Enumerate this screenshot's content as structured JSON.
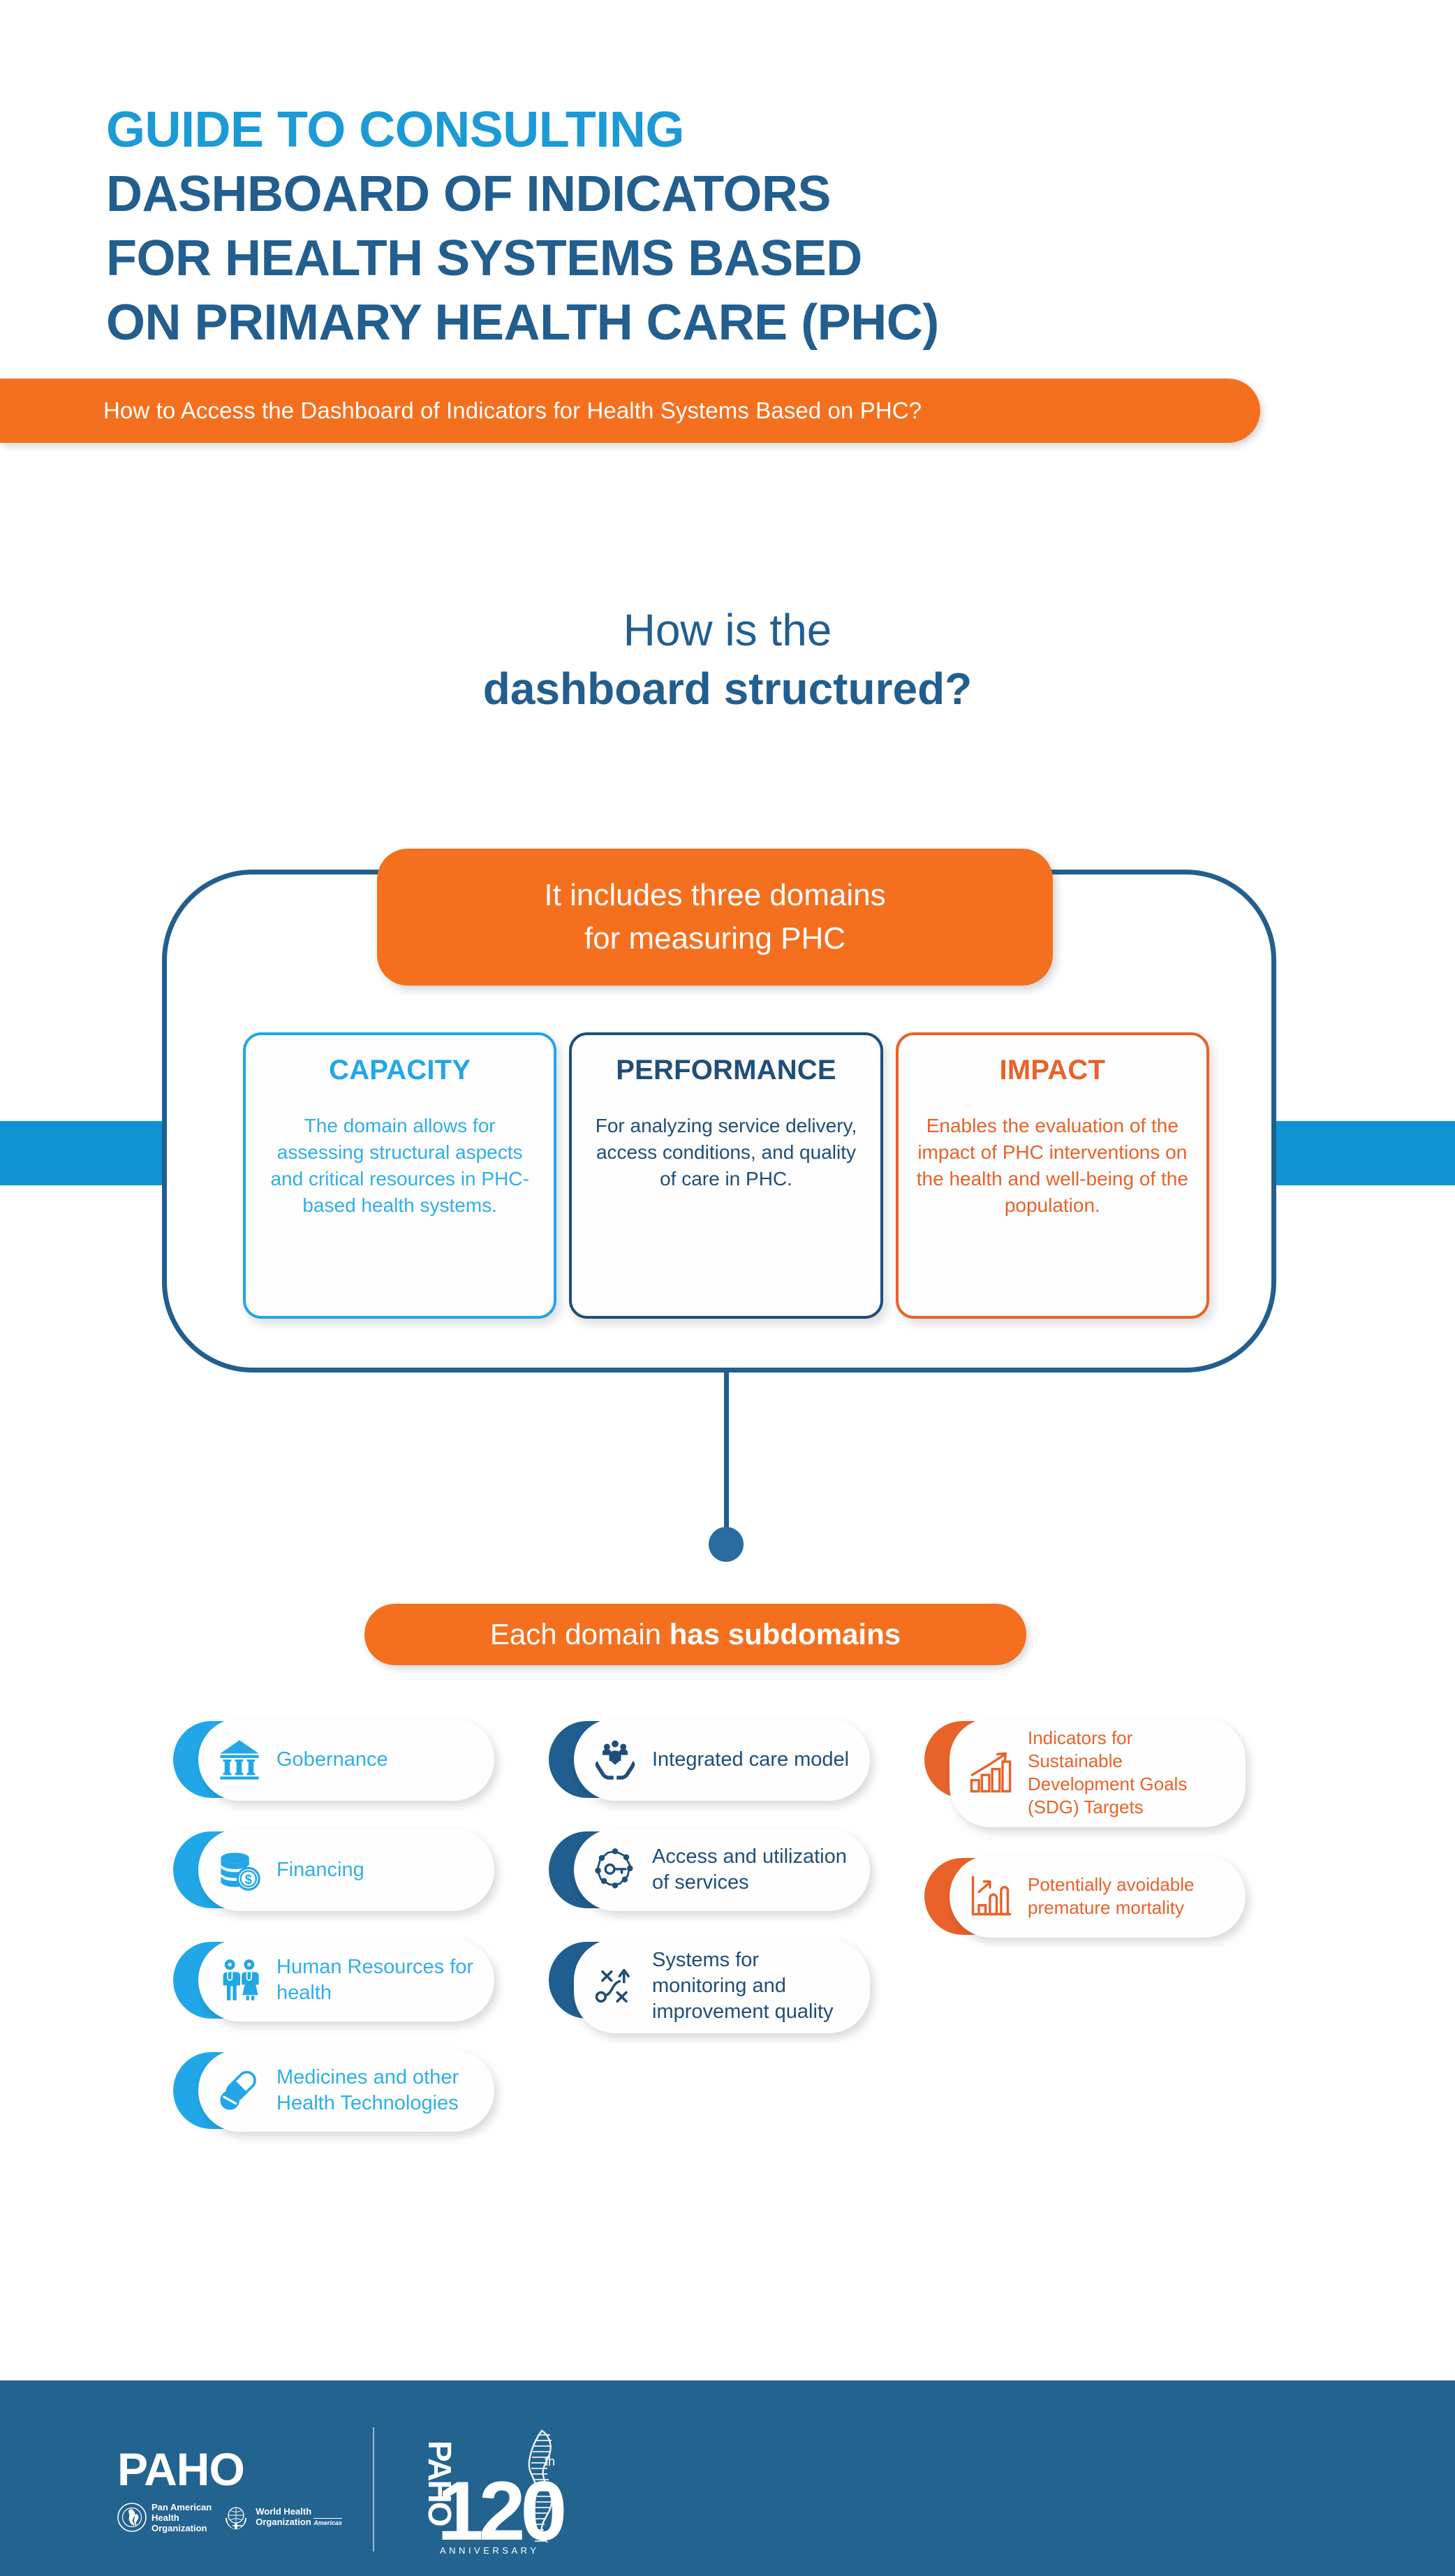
{
  "header": {
    "title_lines": [
      {
        "text": "GUIDE TO CONSULTING",
        "tone": "accent"
      },
      {
        "text": "DASHBOARD OF INDICATORS",
        "tone": "deep"
      },
      {
        "text": "FOR HEALTH SYSTEMS BASED",
        "tone": "deep"
      },
      {
        "text": "ON PRIMARY HEALTH CARE (PHC)",
        "tone": "deep"
      }
    ],
    "banner_text": "How to Access the Dashboard of Indicators for Health Systems Based on PHC?"
  },
  "section": {
    "question_line1": "How is the",
    "question_line2": "dashboard structured?"
  },
  "domains_banner": {
    "line1": "It includes three domains",
    "line2": "for measuring PHC"
  },
  "domains": [
    {
      "key": "capacity",
      "title": "CAPACITY",
      "body": "The domain allows for assessing structural aspects and critical resources in PHC-based health systems.",
      "color": "#21A7E8"
    },
    {
      "key": "performance",
      "title": "PERFORMANCE",
      "body": "For analyzing service delivery, access conditions, and quality of care in PHC.",
      "color": "#1F4E79"
    },
    {
      "key": "impact",
      "title": "IMPACT",
      "body": "Enables the evaluation of the impact of PHC interventions on the health and well-being of the population.",
      "color": "#E8622A"
    }
  ],
  "subdomains_banner": {
    "prefix": "Each domain ",
    "emphasis": "has subdomains"
  },
  "subdomain_columns": [
    {
      "key": "capacity",
      "color": "#21A7E8",
      "items": [
        {
          "label": "Gobernance",
          "icon": "bank-building-icon"
        },
        {
          "label": "Financing",
          "icon": "coins-dollar-icon"
        },
        {
          "label": "Human Resources for health",
          "icon": "health-workers-icon"
        },
        {
          "label": "Medicines and other Health Technologies",
          "icon": "pill-capsule-icon"
        }
      ]
    },
    {
      "key": "performance",
      "color": "#1F5E8F",
      "items": [
        {
          "label": "Integrated care model",
          "icon": "hands-people-heart-icon"
        },
        {
          "label": "Access and utilization of services",
          "icon": "key-network-icon"
        },
        {
          "label": "Systems for monitoring and improvement quality",
          "icon": "pathway-arrow-icon"
        }
      ]
    },
    {
      "key": "impact",
      "color": "#E8622A",
      "items": [
        {
          "label": "Indicators for Sustainable Development Goals (SDG) Targets",
          "icon": "bar-chart-rising-icon"
        },
        {
          "label": "Potentially avoidable premature mortality",
          "icon": "bar-chart-axis-icon"
        }
      ]
    }
  ],
  "footer": {
    "paho_wordmark": "PAHO",
    "pan_american_line1": "Pan American",
    "pan_american_line2": "Health",
    "pan_american_line3": "Organization",
    "who_line1": "World Health",
    "who_line2": "Organization",
    "who_americas": "Americas",
    "anniversary_wordmark": "PAHO",
    "anniversary_number": "120",
    "anniversary_ordinal": "th",
    "anniversary_label": "ANNIVERSARY"
  },
  "colors": {
    "accent_light_blue": "#1B9AD6",
    "deep_blue": "#225E8E",
    "orange": "#F4701F",
    "band_blue": "#0E94D3",
    "footer_blue": "#23638F"
  }
}
